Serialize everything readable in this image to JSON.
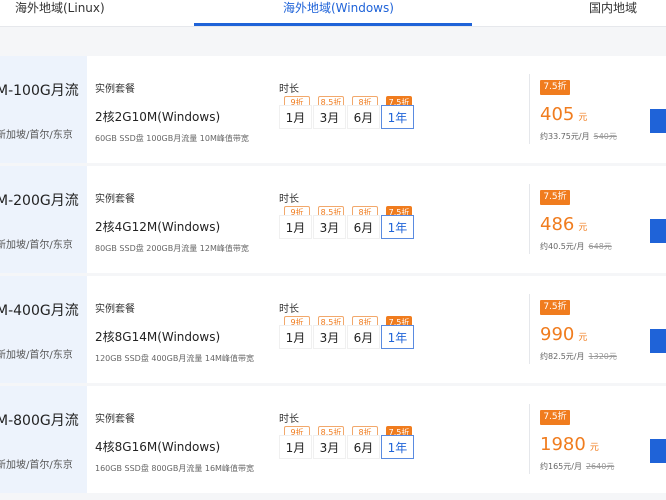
{
  "tabs": [
    {
      "label": "海外地域(Linux)",
      "active": false
    },
    {
      "label": "海外地域(Windows)",
      "active": true
    },
    {
      "label": "国内地域",
      "active": false
    }
  ],
  "labels": {
    "instance": "实例套餐",
    "duration": "时长"
  },
  "durations": [
    {
      "discount": "9折",
      "label": "1月"
    },
    {
      "discount": "8.5折",
      "label": "3月"
    },
    {
      "discount": "8折",
      "label": "6月"
    },
    {
      "discount": "7.5折",
      "label": "1年",
      "active": true
    }
  ],
  "accent_color": "#f07c1e",
  "primary_color": "#1f63d8",
  "plans": [
    {
      "title": "M-100G月流",
      "region": "新加坡/首尔/东京",
      "instance": "2核2G10M(Windows)",
      "spec": "60GB SSD盘 100GB月流量 10M峰值带宽",
      "badge": "7.5折",
      "price": "405",
      "unit": "元",
      "per_month": "约33.75元/月",
      "original": "540元"
    },
    {
      "title": "M-200G月流",
      "region": "新加坡/首尔/东京",
      "instance": "2核4G12M(Windows)",
      "spec": "80GB SSD盘 200GB月流量 12M峰值带宽",
      "badge": "7.5折",
      "price": "486",
      "unit": "元",
      "per_month": "约40.5元/月",
      "original": "648元"
    },
    {
      "title": "M-400G月流",
      "region": "新加坡/首尔/东京",
      "instance": "2核8G14M(Windows)",
      "spec": "120GB SSD盘 400GB月流量 14M峰值带宽",
      "badge": "7.5折",
      "price": "990",
      "unit": "元",
      "per_month": "约82.5元/月",
      "original": "1320元"
    },
    {
      "title": "M-800G月流",
      "region": "新加坡/首尔/东京",
      "instance": "4核8G16M(Windows)",
      "spec": "160GB SSD盘 800GB月流量 16M峰值带宽",
      "badge": "7.5折",
      "price": "1980",
      "unit": "元",
      "per_month": "约165元/月",
      "original": "2640元"
    }
  ]
}
